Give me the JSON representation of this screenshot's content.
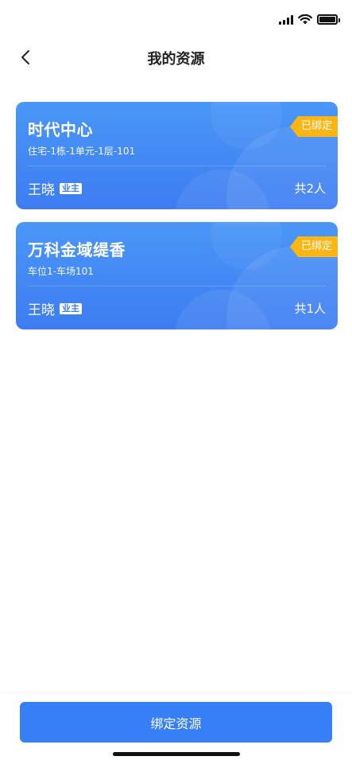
{
  "status_bar": {
    "icons": [
      "signal-icon",
      "wifi-icon",
      "battery-icon"
    ]
  },
  "nav": {
    "back_icon": "chevron-left-icon",
    "title": "我的资源"
  },
  "resources": [
    {
      "name": "时代中心",
      "address": "住宅-1栋-1单元-1层-101",
      "owner": "王晓",
      "owner_tag": "业主",
      "count": "共2人",
      "status": "已绑定"
    },
    {
      "name": "万科金域缇香",
      "address": "车位1-车场101",
      "owner": "王晓",
      "owner_tag": "业主",
      "count": "共1人",
      "status": "已绑定"
    }
  ],
  "bottom": {
    "button_label": "绑定资源"
  },
  "colors": {
    "card_gradient_top": "#4a97f7",
    "card_gradient_bottom": "#3d7cf2",
    "badge": "#fbb614",
    "primary_button": "#377ff6"
  }
}
